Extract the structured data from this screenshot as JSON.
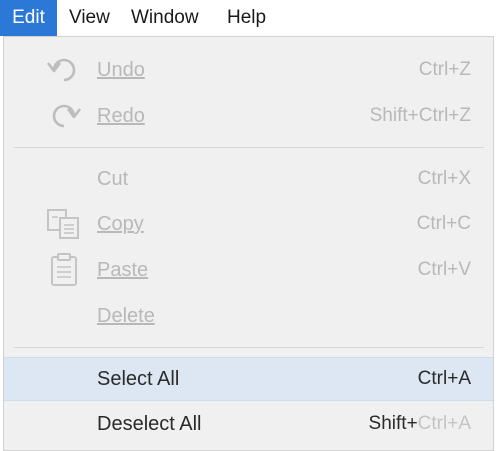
{
  "menubar": {
    "items": [
      {
        "label": "Edit",
        "active": true
      },
      {
        "label": "View",
        "active": false
      },
      {
        "label": "Window",
        "active": false
      },
      {
        "label": "Help",
        "active": false
      }
    ]
  },
  "edit_menu": {
    "undo": {
      "label": "Undo",
      "shortcut": "Ctrl+Z",
      "enabled": false,
      "icon": "undo-arrow-icon"
    },
    "redo": {
      "label": "Redo",
      "shortcut": "Shift+Ctrl+Z",
      "enabled": false,
      "icon": "redo-arrow-icon"
    },
    "cut": {
      "label": "Cut",
      "shortcut": "Ctrl+X",
      "enabled": false
    },
    "copy": {
      "label": "Copy",
      "shortcut": "Ctrl+C",
      "enabled": false,
      "icon": "copy-icon"
    },
    "paste": {
      "label": "Paste",
      "shortcut": "Ctrl+V",
      "enabled": false,
      "icon": "clipboard-icon"
    },
    "delete": {
      "label": "Delete",
      "enabled": false
    },
    "select_all": {
      "label": "Select All",
      "shortcut": "Ctrl+A",
      "enabled": true,
      "highlighted": true
    },
    "deselect_all": {
      "label": "Deselect All",
      "shortcut_prefix": "Shift+",
      "shortcut_suffix": "Ctrl+A",
      "enabled": true
    }
  },
  "colors": {
    "accent": "#2b78d6",
    "highlight": "#dde7f3",
    "menu_bg": "#f0f0f0",
    "disabled_text": "#b8b8b8"
  }
}
